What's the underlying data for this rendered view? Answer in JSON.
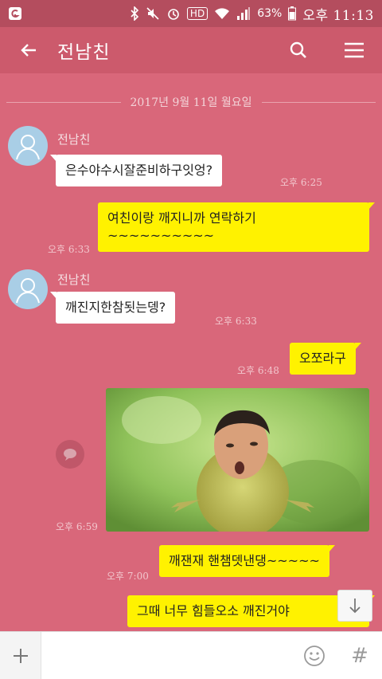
{
  "status_bar": {
    "battery": "63%",
    "time": "오후 11:13",
    "hd_label": "HD"
  },
  "header": {
    "title": "전남친"
  },
  "chat": {
    "date": "2017년 9월 11일 월요일",
    "messages": [
      {
        "sender": "전남친",
        "text": "은수야수시잘준비하구잇엉?",
        "time": "오후 6:25"
      },
      {
        "text": "여친이랑 깨지니까 연락하기\n~~~~~~~~~~",
        "time": "오후 6:33"
      },
      {
        "sender": "전남친",
        "text": "깨진지한참됫는뎅?",
        "time": "오후 6:33"
      },
      {
        "text": "오쪼라구",
        "time": "오후 6:48"
      },
      {
        "time": "오후 6:59"
      },
      {
        "text": "깨잰재 핸챔뎃낸댕~~~~~",
        "time": "오후 7:00"
      },
      {
        "text": "그때 너무 힘들오소 깨진거야"
      }
    ]
  },
  "input": {
    "placeholder": ""
  },
  "colors": {
    "background": "#d9677a",
    "app_bar": "#cc5a6c",
    "status_bar": "#b44d5e",
    "outgoing_bubble": "#fff200",
    "incoming_bubble": "#ffffff"
  }
}
